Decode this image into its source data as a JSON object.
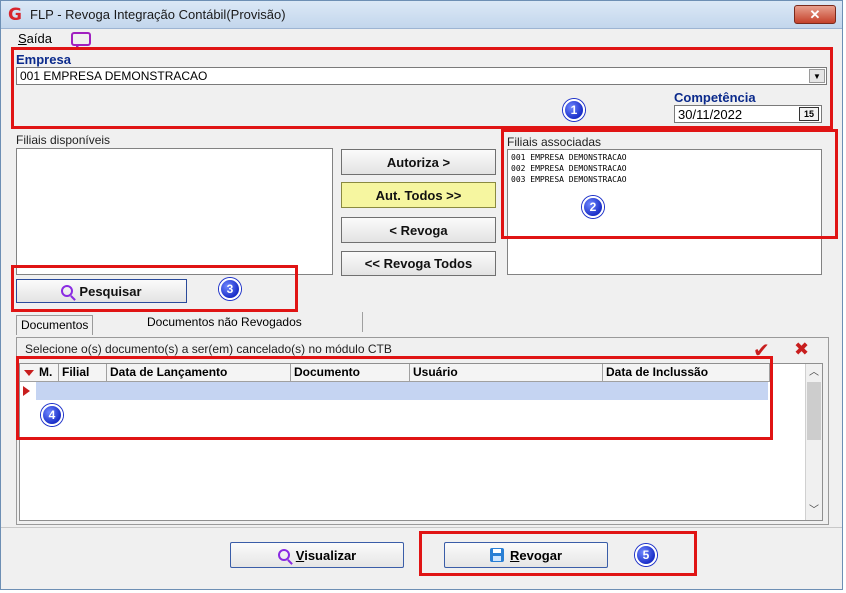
{
  "window": {
    "title": "FLP - Revoga Integração Contábil(Provisão)",
    "close_label": "✕"
  },
  "menu": {
    "saida": "Saída"
  },
  "empresa": {
    "label": "Empresa",
    "value": "001 EMPRESA DEMONSTRACAO"
  },
  "competencia": {
    "label": "Competência",
    "value": "30/11/2022",
    "cal_label": "15"
  },
  "filiais_disponiveis": {
    "label": "Filiais disponíveis",
    "items": []
  },
  "filiais_associadas": {
    "label": "Filiais associadas",
    "items": [
      "001 EMPRESA DEMONSTRACAO",
      "002 EMPRESA DEMONSTRACAO",
      "003 EMPRESA DEMONSTRACAO"
    ]
  },
  "transfer": {
    "autoriza": "Autoriza >",
    "aut_todos": "Aut. Todos >>",
    "revoga": "< Revoga",
    "revoga_todos": "<< Revoga Todos"
  },
  "pesquisar": "Pesquisar",
  "tabs": [
    "Documentos",
    "Documentos não Revogados"
  ],
  "panel": {
    "instruction": "Selecione o(s) documento(s) a ser(em) cancelado(s) no módulo CTB"
  },
  "grid": {
    "columns": [
      "M.",
      "Filial",
      "Data de Lançamento",
      "Documento",
      "Usuário",
      "Data de Inclussão"
    ]
  },
  "badges": [
    "1",
    "2",
    "3",
    "4",
    "5"
  ],
  "actions": {
    "visualizar": "Visualizar",
    "revogar": "Revogar"
  },
  "colors": {
    "accent_red": "#e01414",
    "label_blue": "#0b2a8c",
    "badge_blue": "#1b2fc8"
  }
}
